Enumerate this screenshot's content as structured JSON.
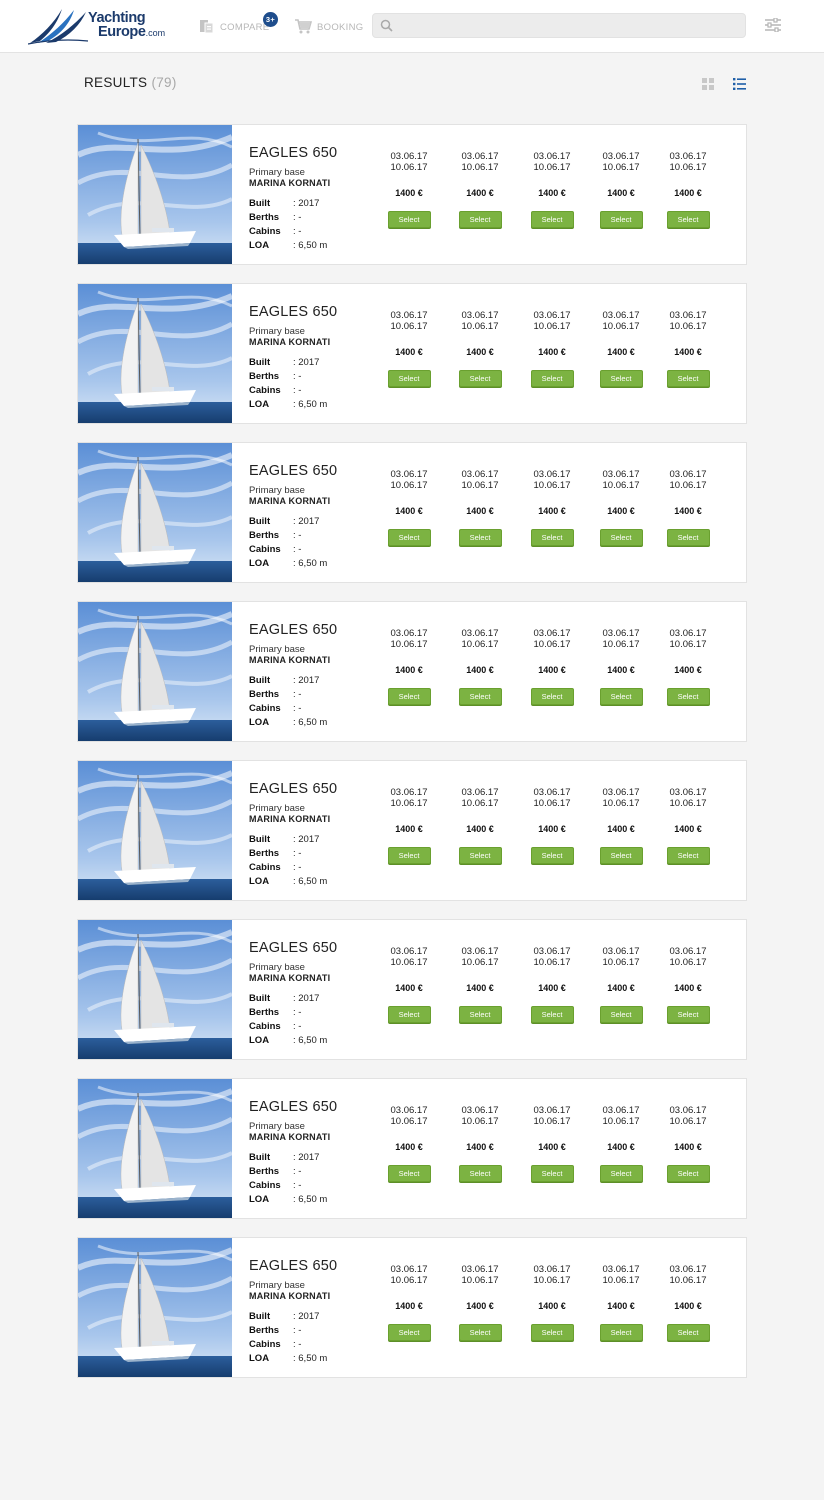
{
  "header": {
    "logo": {
      "line1": "Yachting",
      "line2": "Europe",
      "suffix": ".com"
    },
    "compare_label": "COMPARE",
    "compare_badge": "3+",
    "booking_label": "BOOKING",
    "search": {
      "value": "",
      "placeholder": ""
    }
  },
  "results": {
    "title": "RESULTS",
    "count": "(79)"
  },
  "icons": {
    "logo": "sail-swoosh-icon",
    "compare": "compare-icon",
    "booking": "cart-icon",
    "search": "search-icon",
    "filter": "sliders-icon",
    "grid_view": "grid-view-icon",
    "list_view": "list-view-icon"
  },
  "colors": {
    "brand": "#1b3a6b",
    "accent_blue": "#1e5fa8",
    "select_green": "#7cb342"
  },
  "boats": [
    {
      "name": "EAGLES 650",
      "base_label": "Primary base",
      "base": "MARINA KORNATI",
      "specs": [
        {
          "key": "Built",
          "value": ": 2017"
        },
        {
          "key": "Berths",
          "value": ": -"
        },
        {
          "key": "Cabins",
          "value": ": -"
        },
        {
          "key": "LOA",
          "value": ": 6,50 m"
        }
      ],
      "offers": [
        {
          "from": "03.06.17",
          "to": "10.06.17",
          "price": "1400 €",
          "button": "Select"
        },
        {
          "from": "03.06.17",
          "to": "10.06.17",
          "price": "1400 €",
          "button": "Select"
        },
        {
          "from": "03.06.17",
          "to": "10.06.17",
          "price": "1400 €",
          "button": "Select"
        },
        {
          "from": "03.06.17",
          "to": "10.06.17",
          "price": "1400 €",
          "button": "Select"
        },
        {
          "from": "03.06.17",
          "to": "10.06.17",
          "price": "1400 €",
          "button": "Select"
        }
      ]
    },
    {
      "name": "EAGLES 650",
      "base_label": "Primary base",
      "base": "MARINA KORNATI",
      "specs": [
        {
          "key": "Built",
          "value": ": 2017"
        },
        {
          "key": "Berths",
          "value": ": -"
        },
        {
          "key": "Cabins",
          "value": ": -"
        },
        {
          "key": "LOA",
          "value": ": 6,50 m"
        }
      ],
      "offers": [
        {
          "from": "03.06.17",
          "to": "10.06.17",
          "price": "1400 €",
          "button": "Select"
        },
        {
          "from": "03.06.17",
          "to": "10.06.17",
          "price": "1400 €",
          "button": "Select"
        },
        {
          "from": "03.06.17",
          "to": "10.06.17",
          "price": "1400 €",
          "button": "Select"
        },
        {
          "from": "03.06.17",
          "to": "10.06.17",
          "price": "1400 €",
          "button": "Select"
        },
        {
          "from": "03.06.17",
          "to": "10.06.17",
          "price": "1400 €",
          "button": "Select"
        }
      ]
    },
    {
      "name": "EAGLES 650",
      "base_label": "Primary base",
      "base": "MARINA KORNATI",
      "specs": [
        {
          "key": "Built",
          "value": ": 2017"
        },
        {
          "key": "Berths",
          "value": ": -"
        },
        {
          "key": "Cabins",
          "value": ": -"
        },
        {
          "key": "LOA",
          "value": ": 6,50 m"
        }
      ],
      "offers": [
        {
          "from": "03.06.17",
          "to": "10.06.17",
          "price": "1400 €",
          "button": "Select"
        },
        {
          "from": "03.06.17",
          "to": "10.06.17",
          "price": "1400 €",
          "button": "Select"
        },
        {
          "from": "03.06.17",
          "to": "10.06.17",
          "price": "1400 €",
          "button": "Select"
        },
        {
          "from": "03.06.17",
          "to": "10.06.17",
          "price": "1400 €",
          "button": "Select"
        },
        {
          "from": "03.06.17",
          "to": "10.06.17",
          "price": "1400 €",
          "button": "Select"
        }
      ]
    },
    {
      "name": "EAGLES 650",
      "base_label": "Primary base",
      "base": "MARINA KORNATI",
      "specs": [
        {
          "key": "Built",
          "value": ": 2017"
        },
        {
          "key": "Berths",
          "value": ": -"
        },
        {
          "key": "Cabins",
          "value": ": -"
        },
        {
          "key": "LOA",
          "value": ": 6,50 m"
        }
      ],
      "offers": [
        {
          "from": "03.06.17",
          "to": "10.06.17",
          "price": "1400 €",
          "button": "Select"
        },
        {
          "from": "03.06.17",
          "to": "10.06.17",
          "price": "1400 €",
          "button": "Select"
        },
        {
          "from": "03.06.17",
          "to": "10.06.17",
          "price": "1400 €",
          "button": "Select"
        },
        {
          "from": "03.06.17",
          "to": "10.06.17",
          "price": "1400 €",
          "button": "Select"
        },
        {
          "from": "03.06.17",
          "to": "10.06.17",
          "price": "1400 €",
          "button": "Select"
        }
      ]
    },
    {
      "name": "EAGLES 650",
      "base_label": "Primary base",
      "base": "MARINA KORNATI",
      "specs": [
        {
          "key": "Built",
          "value": ": 2017"
        },
        {
          "key": "Berths",
          "value": ": -"
        },
        {
          "key": "Cabins",
          "value": ": -"
        },
        {
          "key": "LOA",
          "value": ": 6,50 m"
        }
      ],
      "offers": [
        {
          "from": "03.06.17",
          "to": "10.06.17",
          "price": "1400 €",
          "button": "Select"
        },
        {
          "from": "03.06.17",
          "to": "10.06.17",
          "price": "1400 €",
          "button": "Select"
        },
        {
          "from": "03.06.17",
          "to": "10.06.17",
          "price": "1400 €",
          "button": "Select"
        },
        {
          "from": "03.06.17",
          "to": "10.06.17",
          "price": "1400 €",
          "button": "Select"
        },
        {
          "from": "03.06.17",
          "to": "10.06.17",
          "price": "1400 €",
          "button": "Select"
        }
      ]
    },
    {
      "name": "EAGLES 650",
      "base_label": "Primary base",
      "base": "MARINA KORNATI",
      "specs": [
        {
          "key": "Built",
          "value": ": 2017"
        },
        {
          "key": "Berths",
          "value": ": -"
        },
        {
          "key": "Cabins",
          "value": ": -"
        },
        {
          "key": "LOA",
          "value": ": 6,50 m"
        }
      ],
      "offers": [
        {
          "from": "03.06.17",
          "to": "10.06.17",
          "price": "1400 €",
          "button": "Select"
        },
        {
          "from": "03.06.17",
          "to": "10.06.17",
          "price": "1400 €",
          "button": "Select"
        },
        {
          "from": "03.06.17",
          "to": "10.06.17",
          "price": "1400 €",
          "button": "Select"
        },
        {
          "from": "03.06.17",
          "to": "10.06.17",
          "price": "1400 €",
          "button": "Select"
        },
        {
          "from": "03.06.17",
          "to": "10.06.17",
          "price": "1400 €",
          "button": "Select"
        }
      ]
    },
    {
      "name": "EAGLES 650",
      "base_label": "Primary base",
      "base": "MARINA KORNATI",
      "specs": [
        {
          "key": "Built",
          "value": ": 2017"
        },
        {
          "key": "Berths",
          "value": ": -"
        },
        {
          "key": "Cabins",
          "value": ": -"
        },
        {
          "key": "LOA",
          "value": ": 6,50 m"
        }
      ],
      "offers": [
        {
          "from": "03.06.17",
          "to": "10.06.17",
          "price": "1400 €",
          "button": "Select"
        },
        {
          "from": "03.06.17",
          "to": "10.06.17",
          "price": "1400 €",
          "button": "Select"
        },
        {
          "from": "03.06.17",
          "to": "10.06.17",
          "price": "1400 €",
          "button": "Select"
        },
        {
          "from": "03.06.17",
          "to": "10.06.17",
          "price": "1400 €",
          "button": "Select"
        },
        {
          "from": "03.06.17",
          "to": "10.06.17",
          "price": "1400 €",
          "button": "Select"
        }
      ]
    },
    {
      "name": "EAGLES 650",
      "base_label": "Primary base",
      "base": "MARINA KORNATI",
      "specs": [
        {
          "key": "Built",
          "value": ": 2017"
        },
        {
          "key": "Berths",
          "value": ": -"
        },
        {
          "key": "Cabins",
          "value": ": -"
        },
        {
          "key": "LOA",
          "value": ": 6,50 m"
        }
      ],
      "offers": [
        {
          "from": "03.06.17",
          "to": "10.06.17",
          "price": "1400 €",
          "button": "Select"
        },
        {
          "from": "03.06.17",
          "to": "10.06.17",
          "price": "1400 €",
          "button": "Select"
        },
        {
          "from": "03.06.17",
          "to": "10.06.17",
          "price": "1400 €",
          "button": "Select"
        },
        {
          "from": "03.06.17",
          "to": "10.06.17",
          "price": "1400 €",
          "button": "Select"
        },
        {
          "from": "03.06.17",
          "to": "10.06.17",
          "price": "1400 €",
          "button": "Select"
        }
      ]
    }
  ]
}
